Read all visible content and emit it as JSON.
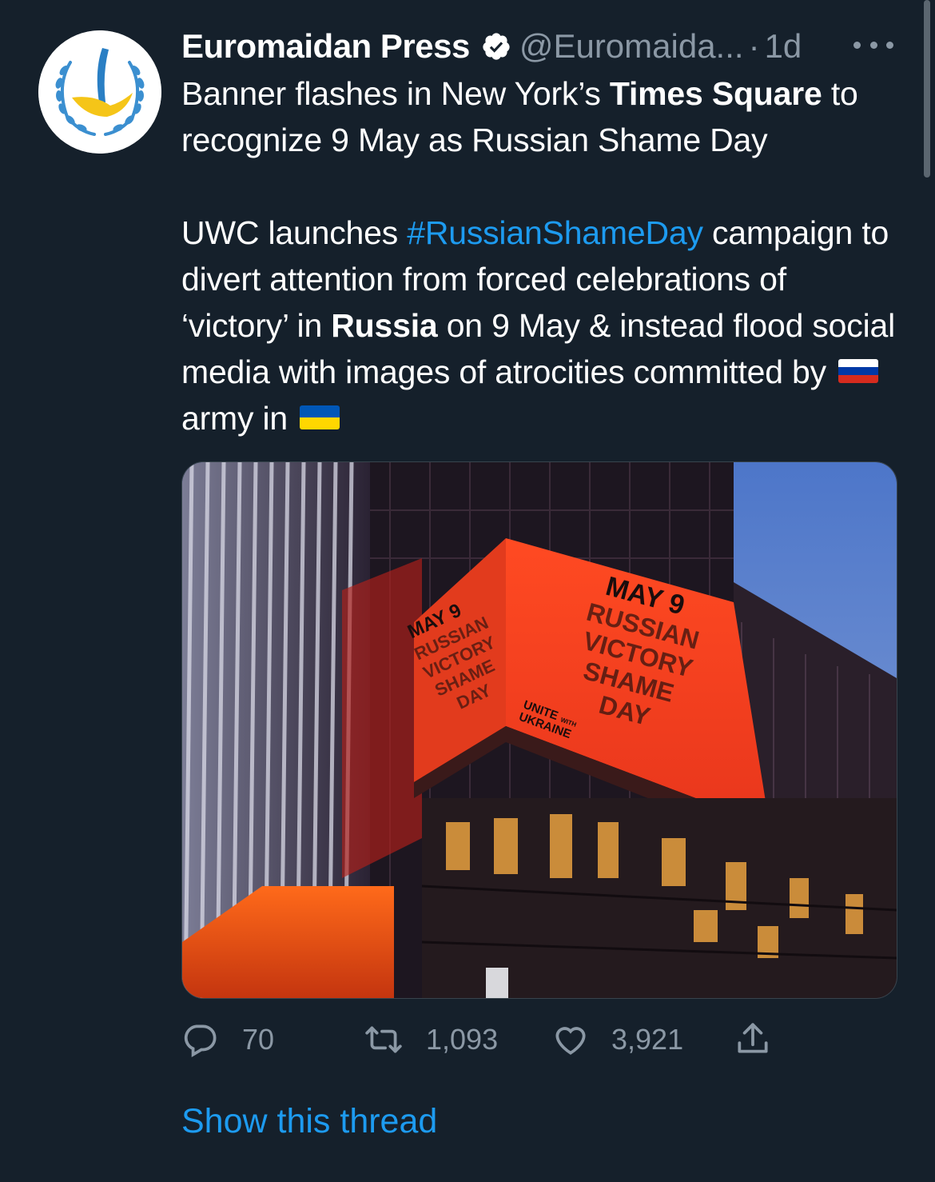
{
  "tweet": {
    "author_name": "Euromaidan Press",
    "handle": "@Euromaida...",
    "separator": "·",
    "time": "1d",
    "text": {
      "line1_prefix": "Banner flashes in New York’s ",
      "line1_bold": "Times Square",
      "line1_suffix": " to recognize 9 May as Russian Shame Day",
      "p2_prefix": "UWC launches ",
      "p2_hashtag": "#RussianShameDay",
      "p2_mid": " campaign to divert attention from forced celebrations of ‘victory’ in ",
      "p2_bold": "Russia",
      "p2_suffix": " on 9 May & instead flood social media with images of atrocities committed by ",
      "p2_tail": "army in "
    },
    "flags": [
      "russia-flag",
      "ukraine-flag"
    ],
    "media": {
      "billboard_front": [
        "MAY 9",
        "RUSSIAN",
        "VICTORY",
        "SHAME",
        "DAY"
      ],
      "billboard_side": [
        "MAY 9",
        "RUSSIAN",
        "VICTORY",
        "SHAME",
        "DAY"
      ],
      "logo_line1": "UNITE",
      "logo_with": "WITH",
      "logo_line2": "UKRAINE"
    }
  },
  "actions": {
    "reply_count": "70",
    "retweet_count": "1,093",
    "like_count": "3,921"
  },
  "show_thread_label": "Show this thread",
  "colors": {
    "background": "#15202b",
    "accent": "#1d9bf0",
    "secondary_text": "#8b98a5",
    "billboard_red": "#e8361c"
  },
  "icons": [
    "more-icon",
    "verified-icon",
    "reply-icon",
    "retweet-icon",
    "like-icon",
    "share-icon"
  ]
}
